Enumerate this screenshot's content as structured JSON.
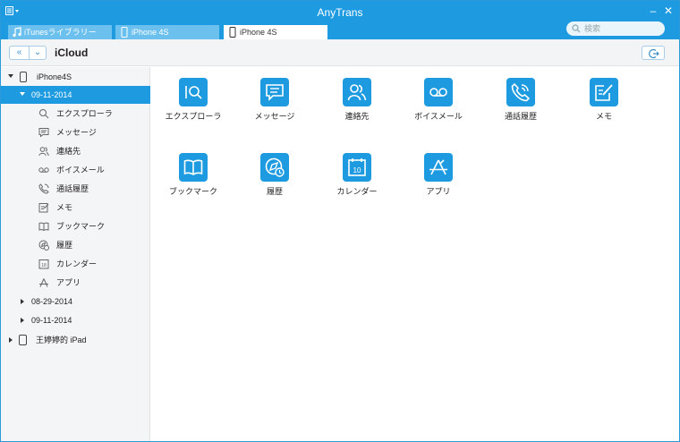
{
  "window": {
    "title": "AnyTrans"
  },
  "tabs": [
    {
      "label": "iTunesライブラリー",
      "icon": "music-note-icon",
      "active": false
    },
    {
      "label": "iPhone 4S",
      "icon": "phone-icon",
      "active": false
    },
    {
      "label": "iPhone 4S",
      "icon": "phone-icon",
      "active": true
    }
  ],
  "search": {
    "placeholder": "検索"
  },
  "toolbar": {
    "location": "iCloud"
  },
  "sidebar": {
    "device": "iPhone4S",
    "backup_selected": "09-11-2014",
    "items": [
      {
        "label": "エクスプローラ",
        "icon": "explorer-icon"
      },
      {
        "label": "メッセージ",
        "icon": "message-icon"
      },
      {
        "label": "連絡先",
        "icon": "contacts-icon"
      },
      {
        "label": "ボイスメール",
        "icon": "voicemail-icon"
      },
      {
        "label": "通話履歴",
        "icon": "call-history-icon"
      },
      {
        "label": "メモ",
        "icon": "notes-icon"
      },
      {
        "label": "ブックマーク",
        "icon": "bookmark-icon"
      },
      {
        "label": "履歴",
        "icon": "history-icon"
      },
      {
        "label": "カレンダー",
        "icon": "calendar-icon"
      },
      {
        "label": "アプリ",
        "icon": "app-store-icon"
      }
    ],
    "other_backups": [
      "08-29-2014",
      "09-11-2014"
    ],
    "other_device": "王婷婷的 iPad"
  },
  "main": {
    "apps": [
      {
        "label": "エクスプローラ",
        "icon": "explorer-icon"
      },
      {
        "label": "メッセージ",
        "icon": "message-icon"
      },
      {
        "label": "連絡先",
        "icon": "contacts-icon"
      },
      {
        "label": "ボイスメール",
        "icon": "voicemail-icon"
      },
      {
        "label": "通話履歴",
        "icon": "call-history-icon"
      },
      {
        "label": "メモ",
        "icon": "notes-icon"
      },
      {
        "label": "ブックマーク",
        "icon": "bookmark-icon"
      },
      {
        "label": "履歴",
        "icon": "history-icon"
      },
      {
        "label": "カレンダー",
        "icon": "calendar-icon"
      },
      {
        "label": "アプリ",
        "icon": "app-store-icon"
      }
    ],
    "calendar_day": "10"
  },
  "colors": {
    "accent": "#1e9be0",
    "tab_inactive": "#6cc0ee",
    "sidebar_bg": "#f4f5f7"
  }
}
